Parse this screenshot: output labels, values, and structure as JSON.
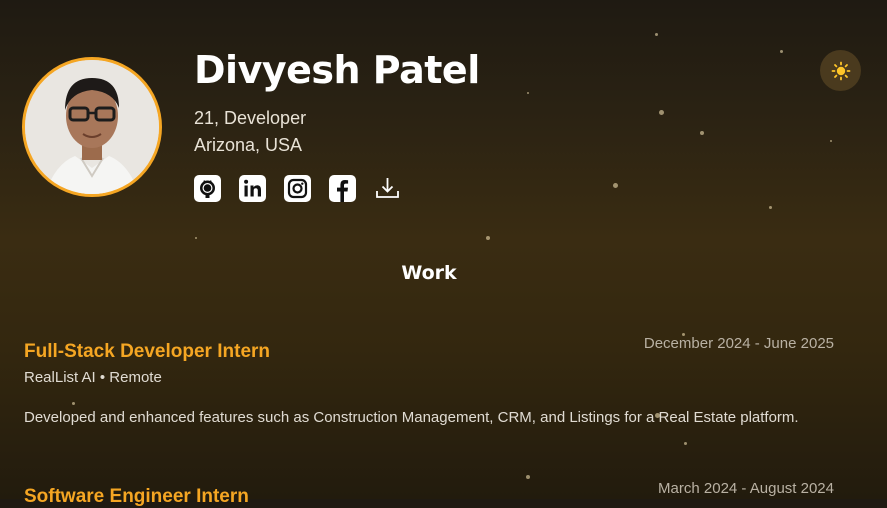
{
  "profile": {
    "name": "Divyesh Patel",
    "age_role": "21, Developer",
    "location": "Arizona, USA"
  },
  "socials": [
    {
      "icon": "github-icon"
    },
    {
      "icon": "linkedin-icon"
    },
    {
      "icon": "instagram-icon"
    },
    {
      "icon": "facebook-icon"
    },
    {
      "icon": "download-icon"
    }
  ],
  "theme_toggle": {
    "icon": "sun-icon"
  },
  "work": {
    "title": "Work",
    "jobs": [
      {
        "title": "Full-Stack Developer Intern",
        "company": "RealList AI • Remote",
        "dates": "December 2024 - June 2025",
        "description": "Developed and enhanced features such as Construction Management, CRM, and Listings for a Real Estate platform."
      },
      {
        "title": "Software Engineer Intern",
        "dates": "March 2024 - August 2024"
      }
    ]
  },
  "colors": {
    "accent": "#f5a623",
    "background_top": "#1f1a12",
    "background_mid": "#3a2c12"
  }
}
